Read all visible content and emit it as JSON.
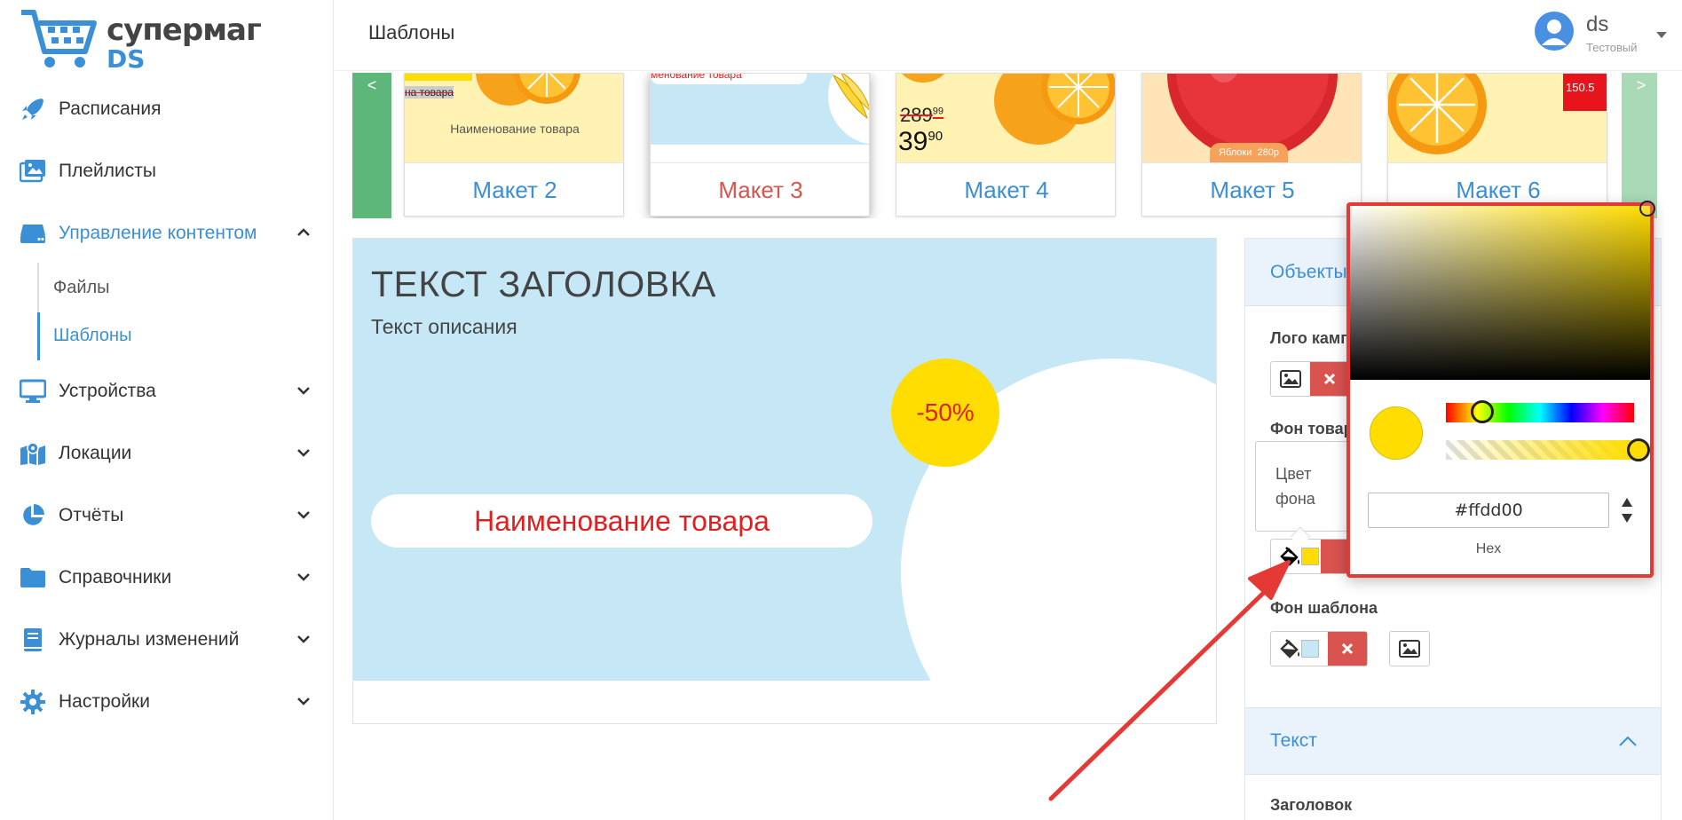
{
  "app": {
    "logo_line1": "супермаг",
    "logo_line2": "DS",
    "page_title": "Шаблоны"
  },
  "user": {
    "name": "ds",
    "role": "Тестовый"
  },
  "sidebar": {
    "items": [
      {
        "label": "Расписания",
        "icon": "rocket-icon"
      },
      {
        "label": "Плейлисты",
        "icon": "images-icon"
      },
      {
        "label": "Управление контентом",
        "icon": "hdd-icon"
      },
      {
        "label": "Устройства",
        "icon": "monitor-icon"
      },
      {
        "label": "Локации",
        "icon": "map-icon"
      },
      {
        "label": "Отчёты",
        "icon": "pie-chart-icon"
      },
      {
        "label": "Справочники",
        "icon": "folder-icon"
      },
      {
        "label": "Журналы изменений",
        "icon": "book-icon"
      },
      {
        "label": "Настройки",
        "icon": "gear-icon"
      }
    ],
    "subitems": [
      {
        "label": "Файлы"
      },
      {
        "label": "Шаблоны"
      }
    ]
  },
  "carousel": {
    "prev": "<",
    "next": ">",
    "cards": [
      {
        "label": "Макет 2",
        "thumb_text": "Наименование товара",
        "thumb_strike": "на товара"
      },
      {
        "label": "Макет 3",
        "thumb_text": "менование товара"
      },
      {
        "label": "Макет 4",
        "old_price": "289",
        "old_price_sup": "99",
        "price": "39",
        "price_sup": "90"
      },
      {
        "label": "Макет 5",
        "tag": "Яблоки  280р"
      },
      {
        "label": "Макет 6",
        "price_tag": "150.5"
      }
    ]
  },
  "preview": {
    "title": "ТЕКСТ ЗАГОЛОВКА",
    "description": "Текст описания",
    "badge": "-50%",
    "product_name": "Наименование товара"
  },
  "panel": {
    "objects_header": "Объекты",
    "logo_label": "Лого кампании",
    "product_bg_label": "Фон товара",
    "color_tooltip": "Цвет фона",
    "template_bg_label": "Фон шаблона",
    "text_header": "Текст",
    "heading_label": "Заголовок",
    "product_bg_color": "#ffdd00",
    "template_bg_color": "#c6e8f6"
  },
  "picker": {
    "hex_value": "#ffdd00",
    "hex_label": "Hex"
  }
}
